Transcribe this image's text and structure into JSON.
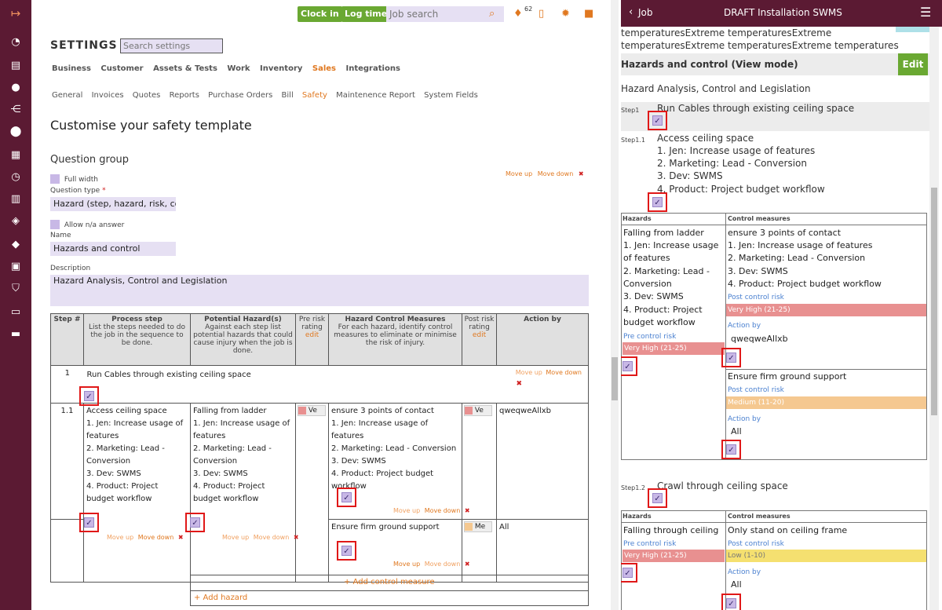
{
  "topbar": {
    "clock_in": "Clock in",
    "log_time": "Log time",
    "job_search_placeholder": "Job search",
    "notif_count": "62"
  },
  "settings": {
    "title": "SETTINGS",
    "search_placeholder": "Search settings"
  },
  "tabs": [
    "Business",
    "Customer",
    "Assets & Tests",
    "Work",
    "Inventory",
    "Sales",
    "Integrations"
  ],
  "subtabs": [
    "General",
    "Invoices",
    "Quotes",
    "Reports",
    "Purchase Orders",
    "Bill",
    "Safety",
    "Maintenence Report",
    "System Fields"
  ],
  "page_title": "Customise your safety template",
  "group": {
    "title": "Question group",
    "full_width": "Full width",
    "question_type_label": "Question type",
    "required_mark": "*",
    "question_type_value": "Hazard (step, hazard, risk, control)",
    "allow_na": "Allow n/a answer",
    "name_label": "Name",
    "name_value": "Hazards and control",
    "description_label": "Description",
    "description_value": "Hazard Analysis, Control and Legislation",
    "move_up": "Move up",
    "move_down": "Move down"
  },
  "table": {
    "headers": {
      "step": "Step #",
      "process": "Process step",
      "process_desc": "List the steps needed to do the job in the sequence to be done.",
      "hazard": "Potential Hazard(s)",
      "hazard_desc": "Against each step list potential hazards that could cause injury when the job is done.",
      "pre": "Pre risk rating",
      "pre_link": "edit",
      "control": "Hazard Control Measures",
      "control_desc": "For each hazard, identify control measures to eliminate or minimise the risk of injury.",
      "post": "Post risk rating",
      "post_link": "edit",
      "action": "Action by"
    },
    "step1": {
      "num": "1",
      "text": "Run Cables through existing ceiling space"
    },
    "step11": {
      "num": "1.1",
      "title": "Access ceiling space",
      "items": [
        "1. Jen: Increase usage of features",
        "2. Marketing: Lead - Conversion",
        "3. Dev: SWMS",
        "4. Product: Project budget workflow"
      ],
      "hazard_title": "Falling from ladder",
      "pre_sel": "Ve",
      "control1": "ensure 3 points of contact",
      "post_sel1": "Ve",
      "action1": "qweqweAllxb",
      "control2": "Ensure firm ground support",
      "post_sel2": "Me",
      "action2": "All"
    },
    "add_control": "+ Add control measure",
    "add_hazard": "+ Add hazard"
  },
  "panel": {
    "back": "Job",
    "title": "DRAFT Installation SWMS",
    "line1": "temperaturesExtreme temperaturesExtreme",
    "line2": "temperaturesExtreme temperaturesExtreme temperatures",
    "section": "Hazards and control (View mode)",
    "edit": "Edit",
    "desc": "Hazard Analysis, Control and Legislation",
    "step1_label": "Step1",
    "step1_text": "Run Cables through existing ceiling space",
    "step11_label": "Step1.1",
    "step11_text": "Access ceiling space",
    "items": [
      "1. Jen: Increase usage of features",
      "2. Marketing: Lead - Conversion",
      "3. Dev: SWMS",
      "4. Product: Project budget workflow"
    ],
    "hazards_col": "Hazards",
    "control_col": "Control measures",
    "hazard1": [
      "Falling from ladder",
      "1. Jen: Increase usage",
      "of features",
      "2. Marketing: Lead -",
      "Conversion",
      "3. Dev: SWMS",
      "4. Product: Project",
      "budget workflow"
    ],
    "pre_risk": "Pre control risk",
    "pre_risk_val": "Very High (21-25)",
    "control1": "ensure 3 points of contact",
    "post_risk": "Post control risk",
    "post_risk_val1": "Very High (21-25)",
    "action_by": "Action by",
    "action1": "qweqweAllxb",
    "control2": "Ensure firm ground support",
    "post_risk_val2": "Medium (11-20)",
    "action2": "All",
    "step12_label": "Step1.2",
    "step12_text": "Crawl through ceiling space",
    "hazard2": "Falling through ceiling",
    "control3": "Only stand on ceiling frame",
    "pre_risk_val2": "Very High (21-25)",
    "post_risk_val3": "Low (1-10)",
    "action3": "All"
  },
  "colors": {
    "brand": "#5b1a33",
    "green": "#6aa832",
    "very_high": "#e89090",
    "medium": "#f5c890",
    "low": "#f5e070"
  }
}
